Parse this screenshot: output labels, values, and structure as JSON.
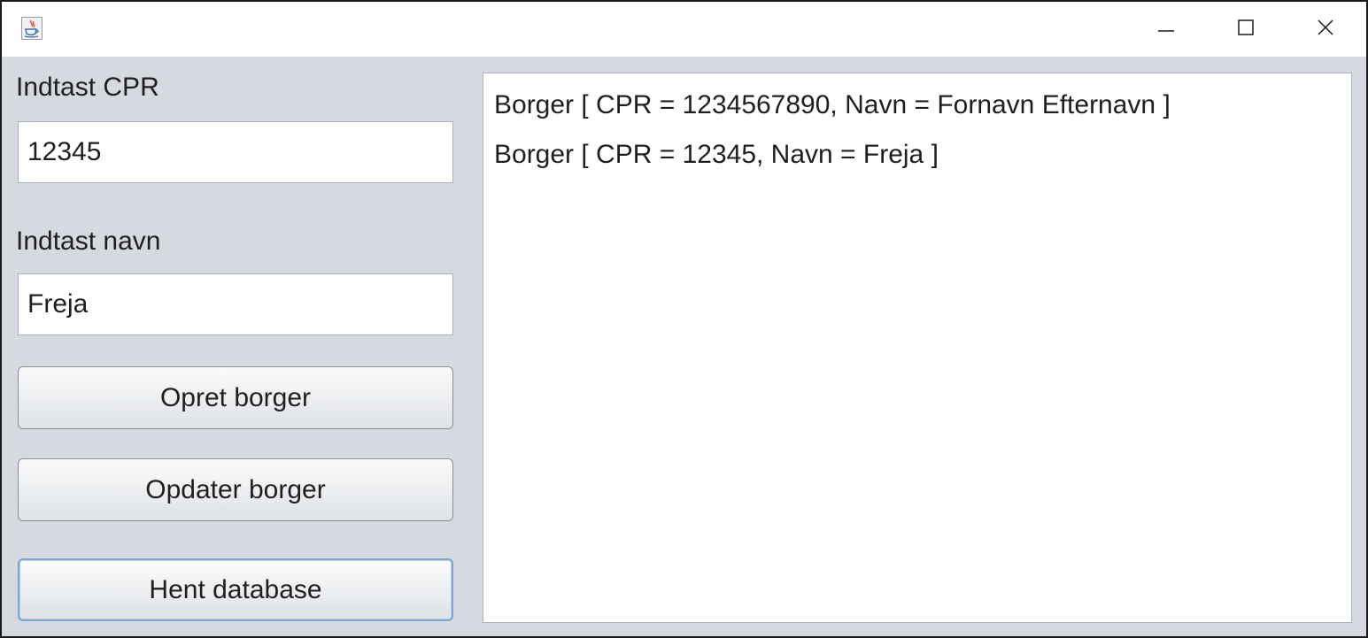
{
  "window": {
    "title": "",
    "icons": [
      "java-cup-icon",
      "minimize-icon",
      "maximize-icon",
      "close-icon"
    ]
  },
  "form": {
    "cpr_label": "Indtast CPR",
    "cpr_value": "12345",
    "name_label": "Indtast navn",
    "name_value": "Freja",
    "buttons": {
      "create": "Opret borger",
      "update": "Opdater borger",
      "fetch": "Hent database"
    }
  },
  "output": {
    "lines": [
      "Borger [ CPR = 1234567890, Navn = Fornavn Efternavn ]",
      "Borger [ CPR = 12345, Navn = Freja ]"
    ]
  },
  "colors": {
    "window_bg": "#d6d9df",
    "titlebar_bg": "#ffffff",
    "focus_border": "#7aa6cf"
  }
}
